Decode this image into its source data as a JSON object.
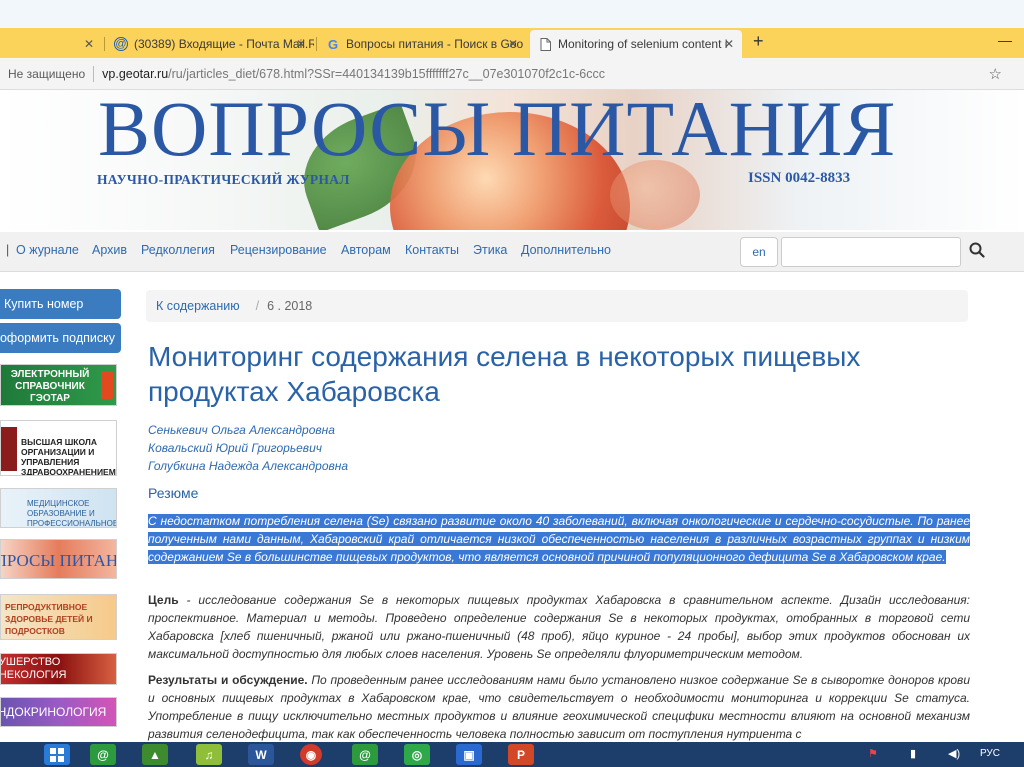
{
  "browser": {
    "tabs": [
      {
        "favicon": "mail-icon",
        "label": "(30389) Входящие - Почта Mail.R"
      },
      {
        "favicon": "google-icon",
        "label": "Вопросы питания - Поиск в Goo"
      },
      {
        "favicon": "page-icon",
        "label": "Monitoring of selenium content i"
      }
    ],
    "new_tab": "+",
    "insecure_label": "Не защищено",
    "url_host": "vp.geotar.ru",
    "url_path": "/ru/jarticles_diet/678.html?SSr=440134139b15fffffff27c__07e301070f2c1c-6ccc"
  },
  "banner": {
    "title": "ВОПРОСЫ ПИТАНИЯ",
    "subtitle": "НАУЧНО-ПРАКТИЧЕСКИЙ ЖУРНАЛ",
    "issn": "ISSN 0042-8833"
  },
  "nav": {
    "items": [
      "О журнале",
      "Архив",
      "Редколлегия",
      "Рецензирование",
      "Авторам",
      "Контакты",
      "Этика",
      "Дополнительно"
    ],
    "lang": "en"
  },
  "sidebar": {
    "buttons": [
      "Купить номер",
      "оформить подписку"
    ],
    "banners": [
      "ЭЛЕКТРОННЫЙ СПРАВОЧНИК ГЭОТАР",
      "ВЫСШАЯ ШКОЛА ОРГАНИЗАЦИИ И УПРАВЛЕНИЯ ЗДРАВООХРАНЕНИЕМ",
      "МЕДИЦИНСКОЕ ОБРАЗОВАНИЕ И ПРОФЕССИОНАЛЬНОЕ РАЗВИТИЕ",
      "ВОПРОСЫ ПИТАНИЯ",
      "РЕПРОДУКТИВНОЕ ЗДОРОВЬЕ ДЕТЕЙ И ПОДРОСТКОВ",
      "АКУШЕРСТВО ГИНЕКОЛОГИЯ",
      "ЭНДОКРИНОЛОГИЯ"
    ]
  },
  "article": {
    "breadcrumb": {
      "link": "К содержанию",
      "sep": "/",
      "issue": "6 . 2018"
    },
    "title": "Мониторинг содержания селена в некоторых пищевых продуктах Хабаровска",
    "authors": [
      "Сенькевич Ольга Александровна",
      "Ковальский Юрий Григорьевич",
      "Голубкина Надежда Александровна"
    ],
    "abstract_heading": "Резюме",
    "abstract_selected": "С недостатком потребления селена (Se) связано развитие около 40 заболеваний, включая онкологические и сердечно-сосудистые. По ранее полученным нами данным, Хабаровский край отличается низкой обеспеченностью населения в различных возрастных группах и низким содержанием Se в большинстве пищевых продуктов, что является основной причиной популяционного дефицита Se в Хабаровском крае.",
    "goal_label": "Цель",
    "goal_text": " - исследование содержания Se в некоторых пищевых продуктах Хабаровска в сравнительном аспекте. Дизайн исследования: проспективное. Материал и методы. Проведено определение содержания Se в некоторых продуктах, отобранных в торговой сети Хабаровска [хлеб пшеничный, ржаной или ржано-пшеничный (48 проб), яйцо куриное - 24 пробы], выбор этих продуктов обоснован их максимальной доступностью для любых слоев населения. Уровень Se определяли флуориметрическим методом.",
    "results_label": "Результаты и обсуждение.",
    "results_text": " По проведенным ранее исследованиям нами было установлено низкое содержание Se в сыворотке доноров крови и основных пищевых продуктах в Хабаровском крае, что свидетельствует о необходимости мониторинга и коррекции Se статуса. Употребление в пищу исключительно местных продуктов и влияние геохимической специфики местности влияют на основной механизм развития селенодефицита, так как обеспеченность человека полностью зависит от поступления нутриента с"
  },
  "taskbar": {
    "lang": "РУС"
  }
}
